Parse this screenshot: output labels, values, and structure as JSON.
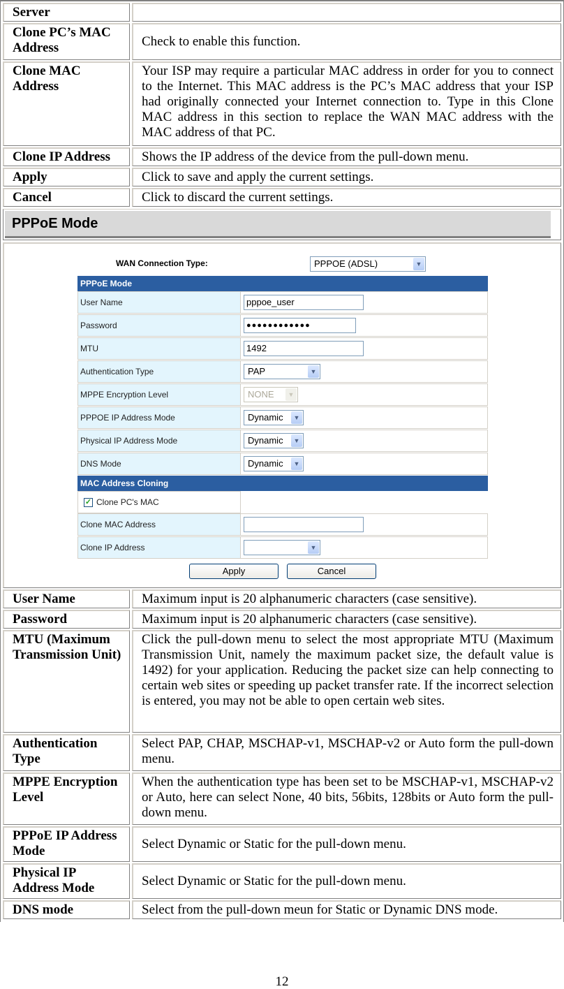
{
  "top_rows": [
    {
      "term": "Server",
      "desc": ""
    },
    {
      "term": "Clone PC’s MAC Address",
      "desc": "Check to enable this function."
    },
    {
      "term": "Clone MAC Address",
      "desc": "Your ISP may require a particular MAC address in order for you to connect to the Internet. This MAC address is the PC’s MAC address that your ISP had originally connected your Internet connection to. Type in this Clone MAC address in this section to replace the WAN MAC address with the MAC address of that PC."
    },
    {
      "term": "Clone IP Address",
      "desc": "Shows the IP address of the device from the pull-down menu."
    },
    {
      "term": "Apply",
      "desc": "Click to save and apply the current settings."
    },
    {
      "term": "Cancel",
      "desc": "Click to discard the current settings."
    }
  ],
  "section_title": "PPPoE Mode",
  "screenshot": {
    "wan_label": "WAN Connection Type:",
    "wan_value": "PPPOE (ADSL)",
    "pppoe_bar": "PPPoE Mode",
    "fields": {
      "user_name": {
        "label": "User Name",
        "value": "pppoe_user"
      },
      "password": {
        "label": "Password",
        "value": "●●●●●●●●●●●●"
      },
      "mtu": {
        "label": "MTU",
        "value": "1492"
      },
      "auth_type": {
        "label": "Authentication Type",
        "value": "PAP"
      },
      "mppe": {
        "label": "MPPE Encryption Level",
        "value": "NONE"
      },
      "pppoe_ip_mode": {
        "label": "PPPOE IP Address Mode",
        "value": "Dynamic"
      },
      "physical_ip_mode": {
        "label": "Physical IP Address Mode",
        "value": "Dynamic"
      },
      "dns_mode": {
        "label": "DNS Mode",
        "value": "Dynamic"
      }
    },
    "mac_bar": "MAC Address Cloning",
    "clone_pc_mac": {
      "label": "Clone PC's MAC",
      "checked": true
    },
    "clone_mac": {
      "label": "Clone MAC Address",
      "value": ""
    },
    "clone_ip": {
      "label": "Clone IP Address",
      "value": ""
    },
    "apply_label": "Apply",
    "cancel_label": "Cancel",
    "colors": {
      "bar": "#2b5ea1",
      "label_bg": "#e3f5fd"
    }
  },
  "bottom_rows": [
    {
      "term": "User Name",
      "desc": "Maximum input is 20 alphanumeric characters (case sensitive)."
    },
    {
      "term": "Password",
      "desc": "Maximum input is 20 alphanumeric characters (case sensitive)."
    },
    {
      "term": "MTU (Maximum Transmission Unit)",
      "desc": "Click the pull-down menu to select the most appropriate MTU (Maximum Transmission Unit, namely the maximum packet size, the default value is 1492) for your application. Reducing the packet size can help connecting to certain web sites or speeding up packet transfer rate. If the incorrect selection is entered, you may not be able to open certain web sites."
    },
    {
      "term": "Authentication Type",
      "desc": "Select PAP, CHAP, MSCHAP-v1, MSCHAP-v2 or Auto form the pull-down menu."
    },
    {
      "term": "MPPE Encryption Level",
      "desc": "When the authentication type has been set to be MSCHAP-v1, MSCHAP-v2 or Auto, here can select None, 40 bits, 56bits, 128bits or Auto form the pull-down menu."
    },
    {
      "term": "PPPoE IP Address Mode",
      "desc": "Select Dynamic or Static for the pull-down menu."
    },
    {
      "term": "Physical IP Address Mode",
      "desc": "Select Dynamic or Static for the pull-down menu."
    },
    {
      "term": "DNS mode",
      "desc": "Select from the pull-down meun for Static or Dynamic DNS mode."
    }
  ],
  "page_number": "12"
}
